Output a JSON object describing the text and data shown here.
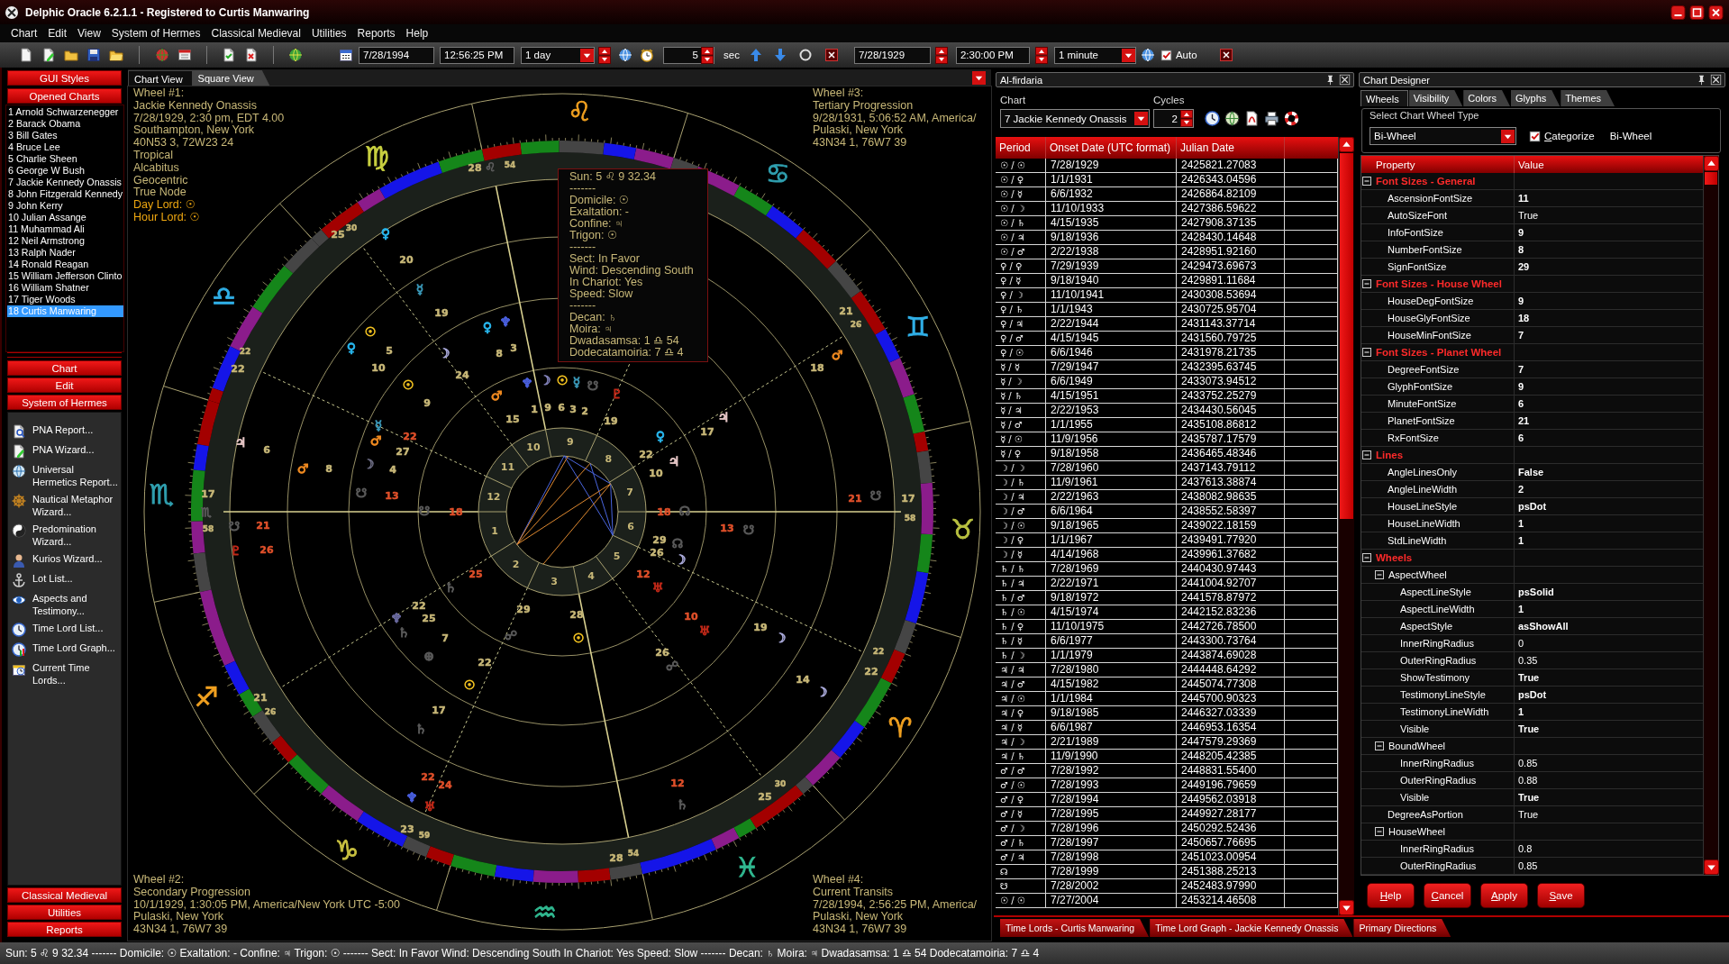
{
  "window": {
    "title": "Delphic Oracle 6.2.1.1 - Registered to Curtis Manwaring"
  },
  "menu": [
    "Chart",
    "Edit",
    "View",
    "System of Hermes",
    "Classical Medieval",
    "Utilities",
    "Reports",
    "Help"
  ],
  "toolbar": {
    "start_date": "7/28/1994",
    "start_time": "12:56:25 PM",
    "step": "1 day",
    "interval": "5",
    "interval_unit": "sec",
    "end_date": "7/28/1929",
    "end_time": "2:30:00 PM",
    "end_step": "1 minute",
    "auto": {
      "label": "Auto",
      "checked": true
    }
  },
  "sidebar": {
    "top_buttons": [
      "GUI Styles",
      "Opened Charts"
    ],
    "charts": [
      {
        "label": "1 Arnold Schwarzenegger",
        "selected": false
      },
      {
        "label": "2 Barack Obama",
        "selected": false
      },
      {
        "label": "3 Bill Gates",
        "selected": false
      },
      {
        "label": "4 Bruce Lee",
        "selected": false
      },
      {
        "label": "5 Charlie Sheen",
        "selected": false
      },
      {
        "label": "6 George W Bush",
        "selected": false
      },
      {
        "label": "7 Jackie Kennedy Onassis",
        "selected": false
      },
      {
        "label": "8 John Fitzgerald Kennedy",
        "selected": false
      },
      {
        "label": "9 John Kerry",
        "selected": false
      },
      {
        "label": "10 Julian Assange",
        "selected": false
      },
      {
        "label": "11 Muhammad Ali",
        "selected": false
      },
      {
        "label": "12 Neil Armstrong",
        "selected": false
      },
      {
        "label": "13 Ralph Nader",
        "selected": false
      },
      {
        "label": "14 Ronald Reagan",
        "selected": false
      },
      {
        "label": "15 William Jefferson Clinto",
        "selected": false
      },
      {
        "label": "16 William Shatner",
        "selected": false
      },
      {
        "label": "17 Tiger Woods",
        "selected": false
      },
      {
        "label": "18 Curtis Manwaring",
        "selected": true
      }
    ],
    "sections": [
      "Chart",
      "Edit",
      "System of Hermes"
    ],
    "items": [
      {
        "label": "PNA Report...",
        "kind": "report"
      },
      {
        "label": "PNA Wizard...",
        "kind": "wizard"
      },
      {
        "label": "Universal Hermetics Report...",
        "kind": "hermetics"
      },
      {
        "label": "Nautical Metaphor Wizard...",
        "kind": "nautical"
      },
      {
        "label": "Predomination Wizard...",
        "kind": "predomination"
      },
      {
        "label": "Kurios Wizard...",
        "kind": "kurios"
      },
      {
        "label": "Lot List...",
        "kind": "lots"
      },
      {
        "label": "Aspects and Testimony...",
        "kind": "aspects"
      },
      {
        "label": "Time Lord List...",
        "kind": "list"
      },
      {
        "label": "Time Lord Graph...",
        "kind": "graph"
      },
      {
        "label": "Current Time Lords...",
        "kind": "current"
      }
    ],
    "bottom_buttons": [
      "Classical Medieval",
      "Utilities",
      "Reports"
    ]
  },
  "chart_view": {
    "tabs": [
      {
        "label": "Chart View",
        "selected": true
      },
      {
        "label": "Square View",
        "selected": false
      }
    ],
    "wheel_info": [
      {
        "lines": [
          "Wheel #1:",
          "Jackie Kennedy Onassis",
          "7/28/1929, 2:30 pm, EDT 4.00",
          "Southampton, New York",
          "40N53 3, 72W23 24",
          "Tropical",
          "Alcabitus",
          "Geocentric",
          "True Node"
        ],
        "lords": [
          "Day Lord: ☉",
          "Hour Lord: ☉"
        ]
      },
      {
        "lines": [
          "Wheel #3:",
          "Tertiary Progression",
          "9/28/1931, 5:06:52 AM, America/",
          "Pulaski, New York",
          "43N34 1, 76W7 39"
        ]
      },
      {
        "lines": [
          "Wheel #2:",
          "Secondary Progression",
          "10/1/1929, 1:30:05 PM, America/New York UTC -5:00",
          "Pulaski, New York",
          "43N34 1, 76W7 39"
        ]
      },
      {
        "lines": [
          "Wheel #4:",
          "Current Transits",
          "7/28/1994, 2:56:25 PM, America/",
          "Pulaski, New York",
          "43N34 1, 76W7 39"
        ]
      }
    ],
    "tooltip": [
      "Sun: 5 ♌ 9 32.34",
      "-------",
      "Domicile: ☉",
      "Exaltation: -",
      "Confine: ♃",
      "Trigon: ☉",
      "-------",
      "Sect: In Favor",
      "Wind: Descending South",
      "In Chariot: Yes",
      "Speed: Slow",
      "-------",
      "Decan: ♄",
      "Moira: ♃",
      "Dwadasamsa: 1 ♎ 54",
      "Dodecatamoiria: 7 ♎ 4"
    ],
    "wheel": {
      "signs": [
        {
          "glyph": "♈",
          "color": "#f0a020"
        },
        {
          "glyph": "♉",
          "color": "#b8c040"
        },
        {
          "glyph": "♊",
          "color": "#30b0e8"
        },
        {
          "glyph": "♋",
          "color": "#30a0b0"
        },
        {
          "glyph": "♌",
          "color": "#f0a020"
        },
        {
          "glyph": "♍",
          "color": "#c8d040"
        },
        {
          "glyph": "♎",
          "color": "#30b0e8"
        },
        {
          "glyph": "♏",
          "color": "#30a0b0"
        },
        {
          "glyph": "♐",
          "color": "#f0a020"
        },
        {
          "glyph": "♑",
          "color": "#c8c040"
        },
        {
          "glyph": "♒",
          "color": "#30b890"
        },
        {
          "glyph": "♓",
          "color": "#30b890"
        }
      ],
      "houses": [
        "1",
        "2",
        "3",
        "4",
        "5",
        "6",
        "7",
        "8",
        "9",
        "10",
        "11",
        "12"
      ],
      "labels": [
        {
          "kind": "degree",
          "text": "28",
          "color": "#c8b878"
        },
        {
          "kind": "cusp",
          "text": "♌",
          "color": "#5a5a5a"
        },
        {
          "kind": "minute",
          "text": "54",
          "color": "#c8b878"
        },
        {
          "kind": "degree",
          "text": "25",
          "color": "#c8b878"
        },
        {
          "kind": "minute",
          "text": "30",
          "color": "#c8b878"
        },
        {
          "kind": "planet",
          "text": "♀",
          "color": "#28b8f0"
        },
        {
          "kind": "degree",
          "text": "20",
          "color": "#c8b878"
        },
        {
          "kind": "planet",
          "text": "☿",
          "color": "#3a98b8"
        },
        {
          "kind": "degree",
          "text": "19",
          "color": "#c8b878"
        },
        {
          "kind": "degree",
          "text": "21",
          "color": "#c8b878"
        },
        {
          "kind": "planet",
          "text": "☉",
          "color": "#f0c020"
        },
        {
          "kind": "planet",
          "text": "♀",
          "color": "#28b8f0"
        },
        {
          "kind": "planet",
          "text": "♆",
          "color": "#4a60e0"
        },
        {
          "kind": "minute",
          "text": "26",
          "color": "#c8b878"
        },
        {
          "kind": "minute",
          "text": "22",
          "color": "#c8b878"
        },
        {
          "kind": "planet",
          "text": "♀",
          "color": "#28b8f0"
        },
        {
          "kind": "degree",
          "text": "5",
          "color": "#c8b878"
        },
        {
          "kind": "planet",
          "text": "☽",
          "color": "#a8a8d8"
        },
        {
          "kind": "degree",
          "text": "8",
          "color": "#c8b878"
        },
        {
          "kind": "degree",
          "text": "3",
          "color": "#c8b878"
        },
        {
          "kind": "planet",
          "text": "♂",
          "color": "#f08a20"
        },
        {
          "kind": "degree",
          "text": "22",
          "color": "#c8b878"
        },
        {
          "kind": "degree",
          "text": "10",
          "color": "#c8b878"
        },
        {
          "kind": "degree",
          "text": "24",
          "color": "#c8b878"
        },
        {
          "kind": "degree",
          "text": "18",
          "color": "#c8b878"
        },
        {
          "kind": "planet",
          "text": "☉",
          "color": "#f0c020"
        },
        {
          "kind": "planet",
          "text": "♆",
          "color": "#4a60e0"
        },
        {
          "kind": "planet",
          "text": "☽",
          "color": "#8080b8"
        },
        {
          "kind": "planet",
          "text": "☉",
          "color": "#f0c020"
        },
        {
          "kind": "planet",
          "text": "☿",
          "color": "#3a98b8"
        },
        {
          "kind": "planet",
          "text": "☋",
          "color": "#5a5a5a"
        },
        {
          "kind": "degree",
          "text": "9",
          "color": "#c8b878"
        },
        {
          "kind": "planet",
          "text": "♂",
          "color": "#f08a20"
        },
        {
          "kind": "planet",
          "text": "♇",
          "color": "#c02818"
        },
        {
          "kind": "degree",
          "text": "1",
          "color": "#c8b878"
        },
        {
          "kind": "degree",
          "text": "9",
          "color": "#c8b878"
        },
        {
          "kind": "degree",
          "text": "6",
          "color": "#c8b878"
        },
        {
          "kind": "degree",
          "text": "3",
          "color": "#c8b878"
        },
        {
          "kind": "degree",
          "text": "2",
          "color": "#c8b878"
        },
        {
          "kind": "planet",
          "text": "☿",
          "color": "#3a98b8"
        },
        {
          "kind": "degree",
          "text": "15",
          "color": "#c8b878"
        },
        {
          "kind": "degree",
          "text": "19",
          "color": "#c8b878"
        },
        {
          "kind": "planet",
          "text": "♃",
          "color": "#e8c8c8"
        },
        {
          "kind": "planet",
          "text": "♃",
          "color": "#e8c8c8"
        },
        {
          "kind": "planet",
          "text": "♂",
          "color": "#f08a20"
        },
        {
          "kind": "degree",
          "text": "22",
          "color": "#e0502a"
        },
        {
          "kind": "planet",
          "text": "♀",
          "color": "#28b8f0"
        },
        {
          "kind": "degree",
          "text": "17",
          "color": "#c8b878"
        },
        {
          "kind": "degree",
          "text": "6",
          "color": "#c8b878"
        },
        {
          "kind": "degree",
          "text": "27",
          "color": "#c8b878"
        },
        {
          "kind": "degree",
          "text": "22",
          "color": "#c8b878"
        },
        {
          "kind": "planet",
          "text": "♂",
          "color": "#f08a20"
        },
        {
          "kind": "degree",
          "text": "8",
          "color": "#c8b878"
        },
        {
          "kind": "planet",
          "text": "☽",
          "color": "#6a6a80"
        },
        {
          "kind": "degree",
          "text": "4",
          "color": "#c8b878"
        },
        {
          "kind": "degree",
          "text": "10",
          "color": "#c8b878"
        },
        {
          "kind": "planet",
          "text": "♃",
          "color": "#e8c8c8"
        },
        {
          "kind": "degree",
          "text": "17",
          "color": "#c8b878"
        },
        {
          "kind": "planet",
          "text": "☋",
          "color": "#5a5a5a"
        },
        {
          "kind": "degree",
          "text": "13",
          "color": "#e0502a"
        },
        {
          "kind": "degree",
          "text": "21",
          "color": "#e0502a"
        },
        {
          "kind": "planet",
          "text": "☋",
          "color": "#5a5a5a"
        },
        {
          "kind": "degree",
          "text": "17",
          "color": "#c8b878"
        },
        {
          "kind": "cusp",
          "text": "♏",
          "color": "#5a5a5a"
        },
        {
          "kind": "planet",
          "text": "☋",
          "color": "#5a5a5a"
        },
        {
          "kind": "degree",
          "text": "18",
          "color": "#e0502a"
        },
        {
          "kind": "degree",
          "text": "18",
          "color": "#e0502a"
        },
        {
          "kind": "planet",
          "text": "☊",
          "color": "#5a5a5a"
        },
        {
          "kind": "minute",
          "text": "58",
          "color": "#c8b878"
        },
        {
          "kind": "minute",
          "text": "58",
          "color": "#c8b878"
        },
        {
          "kind": "planet",
          "text": "☋",
          "color": "#5a5a5a"
        },
        {
          "kind": "degree",
          "text": "21",
          "color": "#e0502a"
        },
        {
          "kind": "degree",
          "text": "13",
          "color": "#e0502a"
        },
        {
          "kind": "planet",
          "text": "☋",
          "color": "#5a5a5a"
        },
        {
          "kind": "planet",
          "text": "♇",
          "color": "#c02818"
        },
        {
          "kind": "degree",
          "text": "26",
          "color": "#e0502a"
        },
        {
          "kind": "degree",
          "text": "29",
          "color": "#c8b878"
        },
        {
          "kind": "degree",
          "text": "26",
          "color": "#c8b878"
        },
        {
          "kind": "planet",
          "text": "☊",
          "color": "#5a5a5a"
        },
        {
          "kind": "planet",
          "text": "☽",
          "color": "#a8a8d8"
        },
        {
          "kind": "degree",
          "text": "25",
          "color": "#e0502a"
        },
        {
          "kind": "degree",
          "text": "12",
          "color": "#e0502a"
        },
        {
          "kind": "planet",
          "text": "♄",
          "color": "#5a5a5a"
        },
        {
          "kind": "planet",
          "text": "♅",
          "color": "#c02818"
        },
        {
          "kind": "planet",
          "text": "♆",
          "color": "#6a6aa0"
        },
        {
          "kind": "degree",
          "text": "22",
          "color": "#c8b878"
        },
        {
          "kind": "degree",
          "text": "25",
          "color": "#c8b878"
        },
        {
          "kind": "degree",
          "text": "29",
          "color": "#c8b878"
        },
        {
          "kind": "degree",
          "text": "28",
          "color": "#c8b878"
        },
        {
          "kind": "degree",
          "text": "10",
          "color": "#e0502a"
        },
        {
          "kind": "planet",
          "text": "♄",
          "color": "#5a5a5a"
        },
        {
          "kind": "degree",
          "text": "7",
          "color": "#c8b878"
        },
        {
          "kind": "planet",
          "text": "☍",
          "color": "#5a5a5a"
        },
        {
          "kind": "planet",
          "text": "☉",
          "color": "#f0c020"
        },
        {
          "kind": "planet",
          "text": "♅",
          "color": "#c02818"
        },
        {
          "kind": "degree",
          "text": "19",
          "color": "#c8b878"
        },
        {
          "kind": "planet",
          "text": "☽",
          "color": "#a8a8d8"
        },
        {
          "kind": "planet",
          "text": "⊕",
          "color": "#5a5a5a"
        },
        {
          "kind": "degree",
          "text": "26",
          "color": "#c8b878"
        },
        {
          "kind": "minute",
          "text": "22",
          "color": "#c8b878"
        },
        {
          "kind": "degree",
          "text": "22",
          "color": "#c8b878"
        },
        {
          "kind": "planet",
          "text": "☍",
          "color": "#5a5a5a"
        },
        {
          "kind": "degree",
          "text": "22",
          "color": "#c8b878"
        },
        {
          "kind": "planet",
          "text": "☉",
          "color": "#f0c020"
        },
        {
          "kind": "degree",
          "text": "14",
          "color": "#c8b878"
        },
        {
          "kind": "degree",
          "text": "21",
          "color": "#c8b878"
        },
        {
          "kind": "planet",
          "text": "☽",
          "color": "#a8a8d8"
        },
        {
          "kind": "minute",
          "text": "26",
          "color": "#c8b878"
        },
        {
          "kind": "degree",
          "text": "17",
          "color": "#c8b878"
        },
        {
          "kind": "planet",
          "text": "♄",
          "color": "#5a5a5a"
        },
        {
          "kind": "degree",
          "text": "22",
          "color": "#e0502a"
        },
        {
          "kind": "degree",
          "text": "24",
          "color": "#e0502a"
        },
        {
          "kind": "degree",
          "text": "12",
          "color": "#e0502a"
        },
        {
          "kind": "minute",
          "text": "30",
          "color": "#c8b878"
        },
        {
          "kind": "planet",
          "text": "♆",
          "color": "#4a60e0"
        },
        {
          "kind": "planet",
          "text": "♅",
          "color": "#c02818"
        },
        {
          "kind": "planet",
          "text": "♄",
          "color": "#5a5a5a"
        },
        {
          "kind": "degree",
          "text": "25",
          "color": "#c8b878"
        },
        {
          "kind": "degree",
          "text": "23",
          "color": "#c8b878"
        },
        {
          "kind": "minute",
          "text": "59",
          "color": "#c8b878"
        },
        {
          "kind": "degree",
          "text": "28",
          "color": "#c8b878"
        },
        {
          "kind": "minute",
          "text": "54",
          "color": "#c8b878"
        }
      ]
    }
  },
  "firdaria": {
    "title": "Al-firdaria",
    "chart_label": "Chart",
    "chart": "7 Jackie Kennedy Onassis",
    "cycles_label": "Cycles",
    "cycles": "2",
    "columns": [
      "Period",
      "Onset Date (UTC format)",
      "Julian Date"
    ],
    "rows": [
      [
        "☉ / ☉",
        "7/28/1929",
        "2425821.27083"
      ],
      [
        "☉ / ♀",
        "1/1/1931",
        "2426343.04596"
      ],
      [
        "☉ / ☿",
        "6/6/1932",
        "2426864.82109"
      ],
      [
        "☉ / ☽",
        "11/10/1933",
        "2427386.59622"
      ],
      [
        "☉ / ♄",
        "4/15/1935",
        "2427908.37135"
      ],
      [
        "☉ / ♃",
        "9/18/1936",
        "2428430.14648"
      ],
      [
        "☉ / ♂",
        "2/22/1938",
        "2428951.92160"
      ],
      [
        "♀ / ♀",
        "7/29/1939",
        "2429473.69673"
      ],
      [
        "♀ / ☿",
        "9/18/1940",
        "2429891.11684"
      ],
      [
        "♀ / ☽",
        "11/10/1941",
        "2430308.53694"
      ],
      [
        "♀ / ♄",
        "1/1/1943",
        "2430725.95704"
      ],
      [
        "♀ / ♃",
        "2/22/1944",
        "2431143.37714"
      ],
      [
        "♀ / ♂",
        "4/15/1945",
        "2431560.79725"
      ],
      [
        "♀ / ☉",
        "6/6/1946",
        "2431978.21735"
      ],
      [
        "☿ / ☿",
        "7/29/1947",
        "2432395.63745"
      ],
      [
        "☿ / ☽",
        "6/6/1949",
        "2433073.94512"
      ],
      [
        "☿ / ♄",
        "4/15/1951",
        "2433752.25279"
      ],
      [
        "☿ / ♃",
        "2/22/1953",
        "2434430.56045"
      ],
      [
        "☿ / ♂",
        "1/1/1955",
        "2435108.86812"
      ],
      [
        "☿ / ☉",
        "11/9/1956",
        "2435787.17579"
      ],
      [
        "☿ / ♀",
        "9/18/1958",
        "2436465.48346"
      ],
      [
        "☽ / ☽",
        "7/28/1960",
        "2437143.79112"
      ],
      [
        "☽ / ♄",
        "11/9/1961",
        "2437613.38874"
      ],
      [
        "☽ / ♃",
        "2/22/1963",
        "2438082.98635"
      ],
      [
        "☽ / ♂",
        "6/6/1964",
        "2438552.58397"
      ],
      [
        "☽ / ☉",
        "9/18/1965",
        "2439022.18159"
      ],
      [
        "☽ / ♀",
        "1/1/1967",
        "2439491.77920"
      ],
      [
        "☽ / ☿",
        "4/14/1968",
        "2439961.37682"
      ],
      [
        "♄ / ♄",
        "7/28/1969",
        "2440430.97443"
      ],
      [
        "♄ / ♃",
        "2/22/1971",
        "2441004.92707"
      ],
      [
        "♄ / ♂",
        "9/18/1972",
        "2441578.87972"
      ],
      [
        "♄ / ☉",
        "4/15/1974",
        "2442152.83236"
      ],
      [
        "♄ / ♀",
        "11/10/1975",
        "2442726.78500"
      ],
      [
        "♄ / ☿",
        "6/6/1977",
        "2443300.73764"
      ],
      [
        "♄ / ☽",
        "1/1/1979",
        "2443874.69028"
      ],
      [
        "♃ / ♃",
        "7/28/1980",
        "2444448.64292"
      ],
      [
        "♃ / ♂",
        "4/15/1982",
        "2445074.77308"
      ],
      [
        "♃ / ☉",
        "1/1/1984",
        "2445700.90323"
      ],
      [
        "♃ / ♀",
        "9/18/1985",
        "2446327.03339"
      ],
      [
        "♃ / ☿",
        "6/6/1987",
        "2446953.16354"
      ],
      [
        "♃ / ☽",
        "2/21/1989",
        "2447579.29369"
      ],
      [
        "♃ / ♄",
        "11/9/1990",
        "2448205.42385"
      ],
      [
        "♂ / ♂",
        "7/28/1992",
        "2448831.55400"
      ],
      [
        "♂ / ☉",
        "7/28/1993",
        "2449196.79659"
      ],
      [
        "♂ / ♀",
        "7/28/1994",
        "2449562.03918"
      ],
      [
        "♂ / ☿",
        "7/28/1995",
        "2449927.28177"
      ],
      [
        "♂ / ☽",
        "7/28/1996",
        "2450292.52436"
      ],
      [
        "♂ / ♄",
        "7/28/1997",
        "2450657.76695"
      ],
      [
        "♂ / ♃",
        "7/28/1998",
        "2451023.00954"
      ],
      [
        "☊",
        "7/28/1999",
        "2451388.25213"
      ],
      [
        "☋",
        "7/28/2002",
        "2452483.97990"
      ],
      [
        "☉ / ☉",
        "7/27/2004",
        "2453214.46508"
      ]
    ]
  },
  "chart_designer": {
    "title": "Chart Designer",
    "tabs": [
      {
        "label": "Wheels",
        "selected": true
      },
      {
        "label": "Visibility",
        "selected": false
      },
      {
        "label": "Colors",
        "selected": false
      },
      {
        "label": "Glyphs",
        "selected": false
      },
      {
        "label": "Themes",
        "selected": false
      }
    ],
    "group_label": "Select Chart Wheel Type",
    "wheel_type": "Bi-Wheel",
    "categorize": {
      "label": "Categorize",
      "checked": true
    },
    "current_type": "Bi-Wheel",
    "columns": [
      "Property",
      "Value"
    ],
    "properties": [
      {
        "name": "Font Sizes - General",
        "expanded": true,
        "children": [
          {
            "name": "AscensionFontSize",
            "value": "11",
            "modified": true
          },
          {
            "name": "AutoSizeFont",
            "value": "True",
            "modified": false
          },
          {
            "name": "InfoFontSize",
            "value": "9",
            "modified": true
          },
          {
            "name": "NumberFontSize",
            "value": "8",
            "modified": true
          },
          {
            "name": "SignFontSize",
            "value": "29",
            "modified": true
          }
        ]
      },
      {
        "name": "Font Sizes - House Wheel",
        "expanded": true,
        "children": [
          {
            "name": "HouseDegFontSize",
            "value": "9",
            "modified": true
          },
          {
            "name": "HouseGlyFontSize",
            "value": "18",
            "modified": true
          },
          {
            "name": "HouseMinFontSize",
            "value": "7",
            "modified": true
          }
        ]
      },
      {
        "name": "Font Sizes - Planet Wheel",
        "expanded": true,
        "children": [
          {
            "name": "DegreeFontSize",
            "value": "7",
            "modified": true
          },
          {
            "name": "GlyphFontSize",
            "value": "9",
            "modified": true
          },
          {
            "name": "MinuteFontSize",
            "value": "6",
            "modified": true
          },
          {
            "name": "PlanetFontSize",
            "value": "21",
            "modified": true
          },
          {
            "name": "RxFontSize",
            "value": "6",
            "modified": true
          }
        ]
      },
      {
        "name": "Lines",
        "expanded": true,
        "children": [
          {
            "name": "AngleLinesOnly",
            "value": "False",
            "modified": true
          },
          {
            "name": "AngleLineWidth",
            "value": "2",
            "modified": true
          },
          {
            "name": "HouseLineStyle",
            "value": "psDot",
            "modified": true
          },
          {
            "name": "HouseLineWidth",
            "value": "1",
            "modified": true
          },
          {
            "name": "StdLineWidth",
            "value": "1",
            "modified": true
          }
        ]
      },
      {
        "name": "Wheels",
        "expanded": true,
        "children": [
          {
            "name": "AspectWheel",
            "expanded": true,
            "children": [
              {
                "name": "AspectLineStyle",
                "value": "psSolid",
                "modified": true
              },
              {
                "name": "AspectLineWidth",
                "value": "1",
                "modified": true
              },
              {
                "name": "AspectStyle",
                "value": "asShowAll",
                "modified": true
              },
              {
                "name": "InnerRingRadius",
                "value": "0",
                "modified": false
              },
              {
                "name": "OuterRingRadius",
                "value": "0.35",
                "modified": false
              },
              {
                "name": "ShowTestimony",
                "value": "True",
                "modified": true
              },
              {
                "name": "TestimonyLineStyle",
                "value": "psDot",
                "modified": true
              },
              {
                "name": "TestimonyLineWidth",
                "value": "1",
                "modified": true
              },
              {
                "name": "Visible",
                "value": "True",
                "modified": true
              }
            ]
          },
          {
            "name": "BoundWheel",
            "expanded": true,
            "children": [
              {
                "name": "InnerRingRadius",
                "value": "0.85",
                "modified": false
              },
              {
                "name": "OuterRingRadius",
                "value": "0.88",
                "modified": false
              },
              {
                "name": "Visible",
                "value": "True",
                "modified": true
              }
            ]
          },
          {
            "name": "DegreeAsPortion",
            "value": "True",
            "modified": false
          },
          {
            "name": "HouseWheel",
            "expanded": true,
            "children": [
              {
                "name": "InnerRingRadius",
                "value": "0.8",
                "modified": false
              },
              {
                "name": "OuterRingRadius",
                "value": "0.85",
                "modified": false
              }
            ]
          }
        ]
      }
    ],
    "buttons": [
      "Help",
      "Cancel",
      "Apply",
      "Save"
    ]
  },
  "dock_tabs": [
    "Time Lords - Curtis Manwaring",
    "Time Lord Graph - Jackie Kennedy Onassis",
    "Primary Directions"
  ],
  "status_bar": "Sun: 5 ♌ 9 32.34 ------- Domicile: ☉ Exaltation: - Confine: ♃ Trigon: ☉ ------- Sect: In Favor Wind: Descending South In Chariot: Yes Speed: Slow ------- Decan: ♄ Moira: ♃ Dwadasamsa: 1 ♎ 54 Dodecatamoiria: 7 ♎ 4"
}
